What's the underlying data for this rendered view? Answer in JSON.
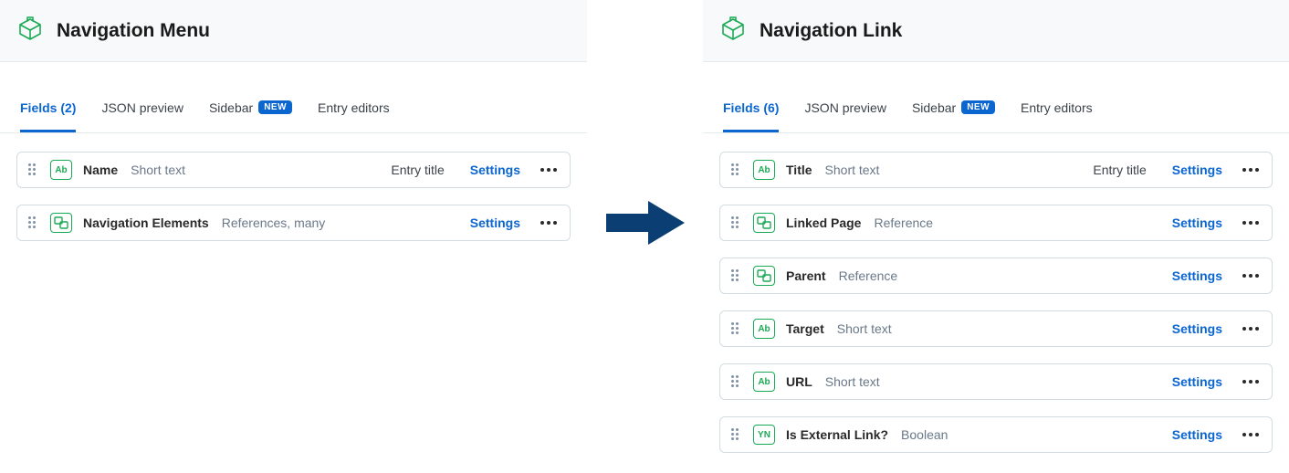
{
  "common": {
    "settings_label": "Settings",
    "entry_title_label": "Entry title",
    "new_badge": "NEW",
    "tabs": {
      "json_preview": "JSON preview",
      "sidebar": "Sidebar",
      "entry_editors": "Entry editors"
    },
    "icons": {
      "content_type": "content-type-icon",
      "text": "Ab",
      "boolean": "YN"
    }
  },
  "left": {
    "title": "Navigation Menu",
    "tab_fields": "Fields (2)",
    "fields": [
      {
        "name": "Name",
        "type": "Short text",
        "icon": "text",
        "entry_title": true
      },
      {
        "name": "Navigation Elements",
        "type": "References, many",
        "icon": "reference",
        "entry_title": false
      }
    ]
  },
  "right": {
    "title": "Navigation Link",
    "tab_fields": "Fields (6)",
    "fields": [
      {
        "name": "Title",
        "type": "Short text",
        "icon": "text",
        "entry_title": true
      },
      {
        "name": "Linked Page",
        "type": "Reference",
        "icon": "reference",
        "entry_title": false
      },
      {
        "name": "Parent",
        "type": "Reference",
        "icon": "reference",
        "entry_title": false
      },
      {
        "name": "Target",
        "type": "Short text",
        "icon": "text",
        "entry_title": false
      },
      {
        "name": "URL",
        "type": "Short text",
        "icon": "text",
        "entry_title": false
      },
      {
        "name": "Is External Link?",
        "type": "Boolean",
        "icon": "boolean",
        "entry_title": false
      }
    ]
  }
}
